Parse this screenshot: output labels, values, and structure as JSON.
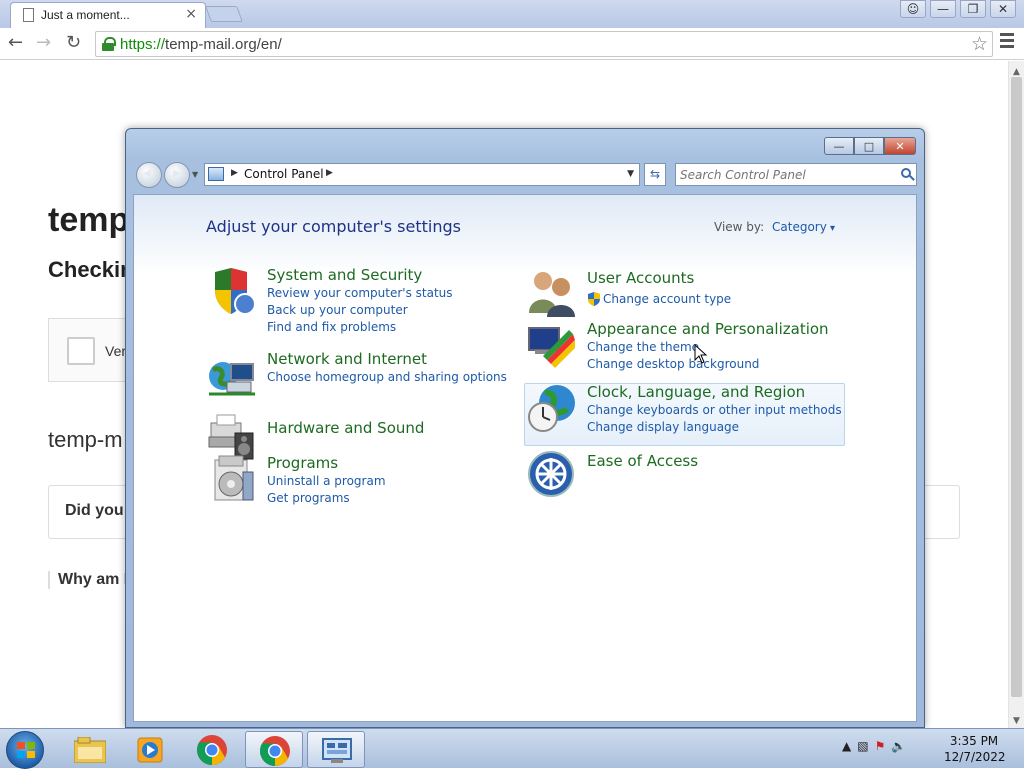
{
  "browser": {
    "tab_title": "Just a moment...",
    "tab_close": "×",
    "url_scheme": "https://",
    "url_rest": "temp-mail.org/en/",
    "star": "☆"
  },
  "webpage": {
    "heading": "temp",
    "subheading": "Checkin",
    "verify_label": "Ver",
    "section_title": "temp-m",
    "card_text": "Did you",
    "why_text": "Why am I"
  },
  "control_panel": {
    "breadcrumb": "Control Panel",
    "search_placeholder": "Search Control Panel",
    "heading": "Adjust your computer's settings",
    "view_by_label": "View by:",
    "view_by_value": "Category",
    "categories_left": [
      {
        "title": "System and Security",
        "links": [
          "Review your computer's status",
          "Back up your computer",
          "Find and fix problems"
        ]
      },
      {
        "title": "Network and Internet",
        "links": [
          "Choose homegroup and sharing options"
        ]
      },
      {
        "title": "Hardware and Sound",
        "links": []
      },
      {
        "title": "Programs",
        "links": [
          "Uninstall a program",
          "Get programs"
        ]
      }
    ],
    "categories_right": [
      {
        "title": "User Accounts",
        "links": [
          "Change account type"
        ]
      },
      {
        "title": "Appearance and Personalization",
        "links": [
          "Change the theme",
          "Change desktop background"
        ]
      },
      {
        "title": "Clock, Language, and Region",
        "links": [
          "Change keyboards or other input methods",
          "Change display language"
        ]
      },
      {
        "title": "Ease of Access",
        "links": []
      }
    ]
  },
  "taskbar": {
    "time": "3:35 PM",
    "date": "12/7/2022",
    "items": [
      "explorer-icon",
      "media-player-icon",
      "chrome-icon",
      "chrome-icon",
      "control-panel-icon"
    ]
  },
  "colors": {
    "category_title": "#1d6b21",
    "link": "#1e5aa8",
    "heading": "#1e3287"
  }
}
